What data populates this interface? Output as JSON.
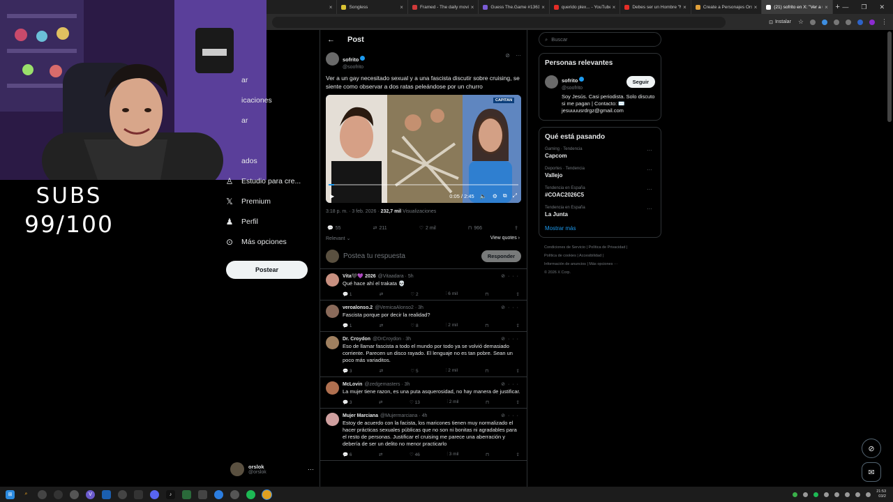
{
  "browser": {
    "tabs": [
      {
        "label": "Songless",
        "color": "#d9c233"
      },
      {
        "label": "Framed - The daily movie",
        "color": "#d13a3a"
      },
      {
        "label": "Guess The.Game #1361",
        "color": "#7a5cd6"
      },
      {
        "label": "querido plex... - YouTube",
        "color": "#e52d27"
      },
      {
        "label": "Debes ser un Hombre \"Ma",
        "color": "#e52d27"
      },
      {
        "label": "Create a Personajes Orslo",
        "color": "#e0a03a"
      },
      {
        "label": "(21) sofrito en X: \"Ver a u",
        "color": "#ffffff"
      }
    ],
    "install_label": "Instalar"
  },
  "overlay": {
    "subs_label": "SUBS",
    "subs_count": "99/100"
  },
  "nav": {
    "items": [
      {
        "label": "ar",
        "icon": "partial-icon"
      },
      {
        "label": "icaciones",
        "icon": "partial-icon"
      },
      {
        "label": "ar",
        "icon": "partial-icon"
      },
      {
        "label": "",
        "icon": "partial-icon"
      },
      {
        "label": "ados",
        "icon": "partial-icon"
      },
      {
        "label": "Estudio para cre...",
        "icon": "studio-icon"
      },
      {
        "label": "Premium",
        "icon": "x-logo-icon"
      },
      {
        "label": "Perfil",
        "icon": "person-icon"
      },
      {
        "label": "Más opciones",
        "icon": "more-circle-icon"
      }
    ],
    "post_button": "Postear",
    "profile_name": "orslok",
    "profile_handle": "@orslok"
  },
  "post": {
    "header": "Post",
    "author_name": "sofrito",
    "author_handle": "@soofrito",
    "text": "Ver a un gay necesitado sexual y a una fascista discutir sobre cruising, se siente como observar a dos ratas peleándose por un churro",
    "video_time": "0:05 / 2:45",
    "video_caption": "CAPITAN",
    "video_progress": 0.03,
    "timestamp": "3:18 p. m. · 3 feb. 2026 · ",
    "views": "232,7 mil",
    "views_label": " Visualizaciones",
    "replies": "55",
    "reposts": "211",
    "likes": "2 mil",
    "bookmarks": "966",
    "sort_label": "Relevant",
    "view_quotes": "View quotes",
    "reply_placeholder": "Postea tu respuesta",
    "reply_button": "Responder"
  },
  "comments": [
    {
      "name": "Vita🖤💜 2026",
      "handle": "@Vitaadara · 5h",
      "text": "Qué hace ahí el trakata 💀",
      "replies": "1",
      "reposts": "",
      "likes": "2",
      "views": "6 mil"
    },
    {
      "name": "veroalonso.2",
      "handle": "@VernicaAlonso2 · 3h",
      "text": "Fascista porque por decir la realidad?",
      "replies": "1",
      "reposts": "",
      "likes": "8",
      "views": "2 mil"
    },
    {
      "name": "Dr. Croydon",
      "handle": "@DrCroydon · 3h",
      "text": "Eso de llamar fascista a todo el mundo por todo ya se volvió demasiado corriente. Parecen un disco rayado. El lenguaje no es tan pobre. Sean un poco más variaditos.",
      "replies": "3",
      "reposts": "",
      "likes": "5",
      "views": "2 mil"
    },
    {
      "name": "McLovin",
      "handle": "@zedgemasters · 3h",
      "text": "La mujer tiene razon, es una puta asquerosidad, no hay manera de justificar.",
      "replies": "3",
      "reposts": "",
      "likes": "13",
      "views": "2 mil"
    },
    {
      "name": "Mujer Marciana",
      "handle": "@Mujermarciana · 4h",
      "text": "Estoy de acuerdo con la facista, los maricones tienen muy normalizado el hacer prácticas sexuales públicas que no son ni bonitas ni agradables para el resto de personas. Justificar el cruising me parece una aberración y debería de ser un delito no menor practicarlo",
      "replies": "6",
      "reposts": "",
      "likes": "46",
      "views": "3 mil"
    }
  ],
  "sidebar": {
    "search_placeholder": "Buscar",
    "relevant_title": "Personas relevantes",
    "relevant_name": "sofrito",
    "relevant_handle": "@soofrito",
    "follow_button": "Seguir",
    "relevant_bio": "Soy Jesús. Casi periodista. Solo discuto si me pagan | Contacto: ✉️ jesuuuusrdrgz@gmail.com",
    "trends_title": "Qué está pasando",
    "trends": [
      {
        "category": "Gaming · Tendencia",
        "name": "Capcom"
      },
      {
        "category": "Deportes · Tendencia",
        "name": "Vallejo"
      },
      {
        "category": "Tendencia en España",
        "name": "#COAC2026C5"
      },
      {
        "category": "Tendencia en España",
        "name": "La Junta"
      }
    ],
    "show_more": "Mostrar más",
    "footer_1": "Condiciones de Servicio  |  Política de Privacidad  |",
    "footer_2": "Política de cookies  |  Accesibilidad  |",
    "footer_3": "Información de anuncios  |  Más opciones ···",
    "footer_4": "© 2026 X Corp."
  },
  "clock": {
    "time": "21:53",
    "date": "03/2"
  },
  "colors": {
    "accent": "#1d9bf0",
    "border": "#2f3336",
    "muted": "#71767b"
  }
}
